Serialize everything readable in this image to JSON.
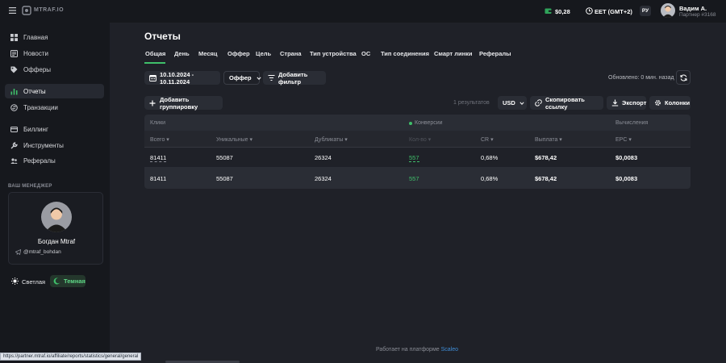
{
  "app": {
    "brand": "MTRAF.IO"
  },
  "topbar": {
    "balance": "$0,28",
    "timezone": "EET (GMT+2)",
    "language": "РУ",
    "user_name": "Вадим А.",
    "user_role": "Партнер #3168"
  },
  "sidebar": {
    "items": [
      {
        "label": "Главная",
        "icon": "dashboard-icon"
      },
      {
        "label": "Новости",
        "icon": "news-icon"
      },
      {
        "label": "Офферы",
        "icon": "tag-icon"
      },
      {
        "label": "Отчеты",
        "icon": "chart-icon"
      },
      {
        "label": "Транзакции",
        "icon": "transactions-icon"
      },
      {
        "label": "Биллинг",
        "icon": "card-icon"
      },
      {
        "label": "Инструменты",
        "icon": "wrench-icon"
      },
      {
        "label": "Рефералы",
        "icon": "referrals-icon"
      }
    ],
    "manager_title": "ВАШ МЕНЕДЖЕР",
    "manager_name": "Богдан Mtraf",
    "manager_telegram": "@mtraf_bohdan",
    "theme_light": "Светлая",
    "theme_dark": "Темная"
  },
  "page": {
    "title": "Отчеты",
    "tabs": [
      "Общая",
      "День",
      "Месяц",
      "Оффер",
      "Цель",
      "Страна",
      "Тип устройства",
      "ОС",
      "Тип соединения",
      "Смарт линки",
      "Рефералы"
    ],
    "active_tab": "Общая",
    "date_range": "10.10.2024 - 10.11.2024",
    "group_select": "Оффер",
    "add_filter": "Добавить фильтр",
    "updated": "Обновлено: 0 мин. назад",
    "add_grouping": "Добавить группировку",
    "results": "1 результатов",
    "currency": "USD",
    "copy_link": "Скопировать ссылку",
    "export": "Экспорт",
    "columns": "Колонки"
  },
  "table": {
    "groups": [
      "Клики",
      "Конверсии",
      "Вычисления"
    ],
    "headers": [
      "Всего",
      "Уникальные",
      "Дубликаты",
      "Кол-во",
      "CR",
      "Выплата",
      "EPC"
    ],
    "rows": [
      [
        "81411",
        "55087",
        "26324",
        "557",
        "0,68%",
        "$678,42",
        "$0,0083"
      ],
      [
        "81411",
        "55087",
        "26324",
        "557",
        "0,68%",
        "$678,42",
        "$0,0083"
      ]
    ]
  },
  "footer": {
    "text": "Работает на платформе",
    "link": "Scaleo",
    "status_url": "https://partner.mtraf.io/affiliate/reports/statistics/general/general"
  }
}
